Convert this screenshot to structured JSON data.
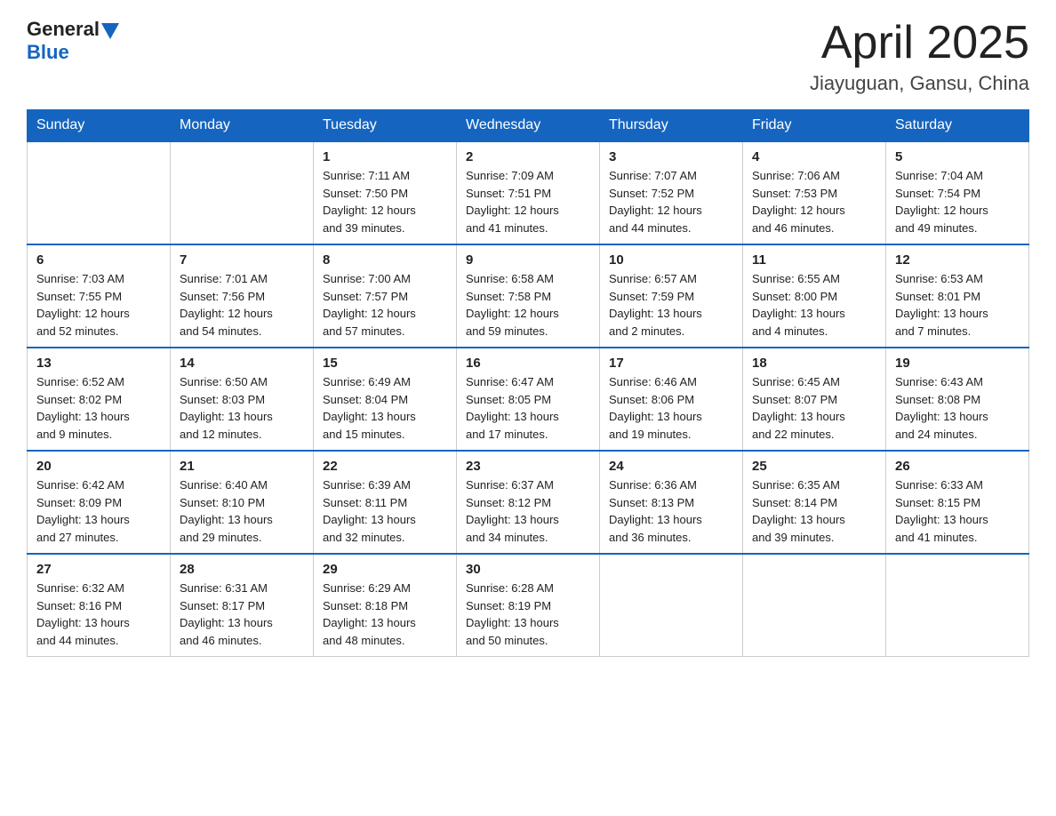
{
  "header": {
    "logo_general": "General",
    "logo_blue": "Blue",
    "month_title": "April 2025",
    "location": "Jiayuguan, Gansu, China"
  },
  "weekdays": [
    "Sunday",
    "Monday",
    "Tuesday",
    "Wednesday",
    "Thursday",
    "Friday",
    "Saturday"
  ],
  "weeks": [
    [
      {
        "day": "",
        "info": ""
      },
      {
        "day": "",
        "info": ""
      },
      {
        "day": "1",
        "info": "Sunrise: 7:11 AM\nSunset: 7:50 PM\nDaylight: 12 hours\nand 39 minutes."
      },
      {
        "day": "2",
        "info": "Sunrise: 7:09 AM\nSunset: 7:51 PM\nDaylight: 12 hours\nand 41 minutes."
      },
      {
        "day": "3",
        "info": "Sunrise: 7:07 AM\nSunset: 7:52 PM\nDaylight: 12 hours\nand 44 minutes."
      },
      {
        "day": "4",
        "info": "Sunrise: 7:06 AM\nSunset: 7:53 PM\nDaylight: 12 hours\nand 46 minutes."
      },
      {
        "day": "5",
        "info": "Sunrise: 7:04 AM\nSunset: 7:54 PM\nDaylight: 12 hours\nand 49 minutes."
      }
    ],
    [
      {
        "day": "6",
        "info": "Sunrise: 7:03 AM\nSunset: 7:55 PM\nDaylight: 12 hours\nand 52 minutes."
      },
      {
        "day": "7",
        "info": "Sunrise: 7:01 AM\nSunset: 7:56 PM\nDaylight: 12 hours\nand 54 minutes."
      },
      {
        "day": "8",
        "info": "Sunrise: 7:00 AM\nSunset: 7:57 PM\nDaylight: 12 hours\nand 57 minutes."
      },
      {
        "day": "9",
        "info": "Sunrise: 6:58 AM\nSunset: 7:58 PM\nDaylight: 12 hours\nand 59 minutes."
      },
      {
        "day": "10",
        "info": "Sunrise: 6:57 AM\nSunset: 7:59 PM\nDaylight: 13 hours\nand 2 minutes."
      },
      {
        "day": "11",
        "info": "Sunrise: 6:55 AM\nSunset: 8:00 PM\nDaylight: 13 hours\nand 4 minutes."
      },
      {
        "day": "12",
        "info": "Sunrise: 6:53 AM\nSunset: 8:01 PM\nDaylight: 13 hours\nand 7 minutes."
      }
    ],
    [
      {
        "day": "13",
        "info": "Sunrise: 6:52 AM\nSunset: 8:02 PM\nDaylight: 13 hours\nand 9 minutes."
      },
      {
        "day": "14",
        "info": "Sunrise: 6:50 AM\nSunset: 8:03 PM\nDaylight: 13 hours\nand 12 minutes."
      },
      {
        "day": "15",
        "info": "Sunrise: 6:49 AM\nSunset: 8:04 PM\nDaylight: 13 hours\nand 15 minutes."
      },
      {
        "day": "16",
        "info": "Sunrise: 6:47 AM\nSunset: 8:05 PM\nDaylight: 13 hours\nand 17 minutes."
      },
      {
        "day": "17",
        "info": "Sunrise: 6:46 AM\nSunset: 8:06 PM\nDaylight: 13 hours\nand 19 minutes."
      },
      {
        "day": "18",
        "info": "Sunrise: 6:45 AM\nSunset: 8:07 PM\nDaylight: 13 hours\nand 22 minutes."
      },
      {
        "day": "19",
        "info": "Sunrise: 6:43 AM\nSunset: 8:08 PM\nDaylight: 13 hours\nand 24 minutes."
      }
    ],
    [
      {
        "day": "20",
        "info": "Sunrise: 6:42 AM\nSunset: 8:09 PM\nDaylight: 13 hours\nand 27 minutes."
      },
      {
        "day": "21",
        "info": "Sunrise: 6:40 AM\nSunset: 8:10 PM\nDaylight: 13 hours\nand 29 minutes."
      },
      {
        "day": "22",
        "info": "Sunrise: 6:39 AM\nSunset: 8:11 PM\nDaylight: 13 hours\nand 32 minutes."
      },
      {
        "day": "23",
        "info": "Sunrise: 6:37 AM\nSunset: 8:12 PM\nDaylight: 13 hours\nand 34 minutes."
      },
      {
        "day": "24",
        "info": "Sunrise: 6:36 AM\nSunset: 8:13 PM\nDaylight: 13 hours\nand 36 minutes."
      },
      {
        "day": "25",
        "info": "Sunrise: 6:35 AM\nSunset: 8:14 PM\nDaylight: 13 hours\nand 39 minutes."
      },
      {
        "day": "26",
        "info": "Sunrise: 6:33 AM\nSunset: 8:15 PM\nDaylight: 13 hours\nand 41 minutes."
      }
    ],
    [
      {
        "day": "27",
        "info": "Sunrise: 6:32 AM\nSunset: 8:16 PM\nDaylight: 13 hours\nand 44 minutes."
      },
      {
        "day": "28",
        "info": "Sunrise: 6:31 AM\nSunset: 8:17 PM\nDaylight: 13 hours\nand 46 minutes."
      },
      {
        "day": "29",
        "info": "Sunrise: 6:29 AM\nSunset: 8:18 PM\nDaylight: 13 hours\nand 48 minutes."
      },
      {
        "day": "30",
        "info": "Sunrise: 6:28 AM\nSunset: 8:19 PM\nDaylight: 13 hours\nand 50 minutes."
      },
      {
        "day": "",
        "info": ""
      },
      {
        "day": "",
        "info": ""
      },
      {
        "day": "",
        "info": ""
      }
    ]
  ]
}
